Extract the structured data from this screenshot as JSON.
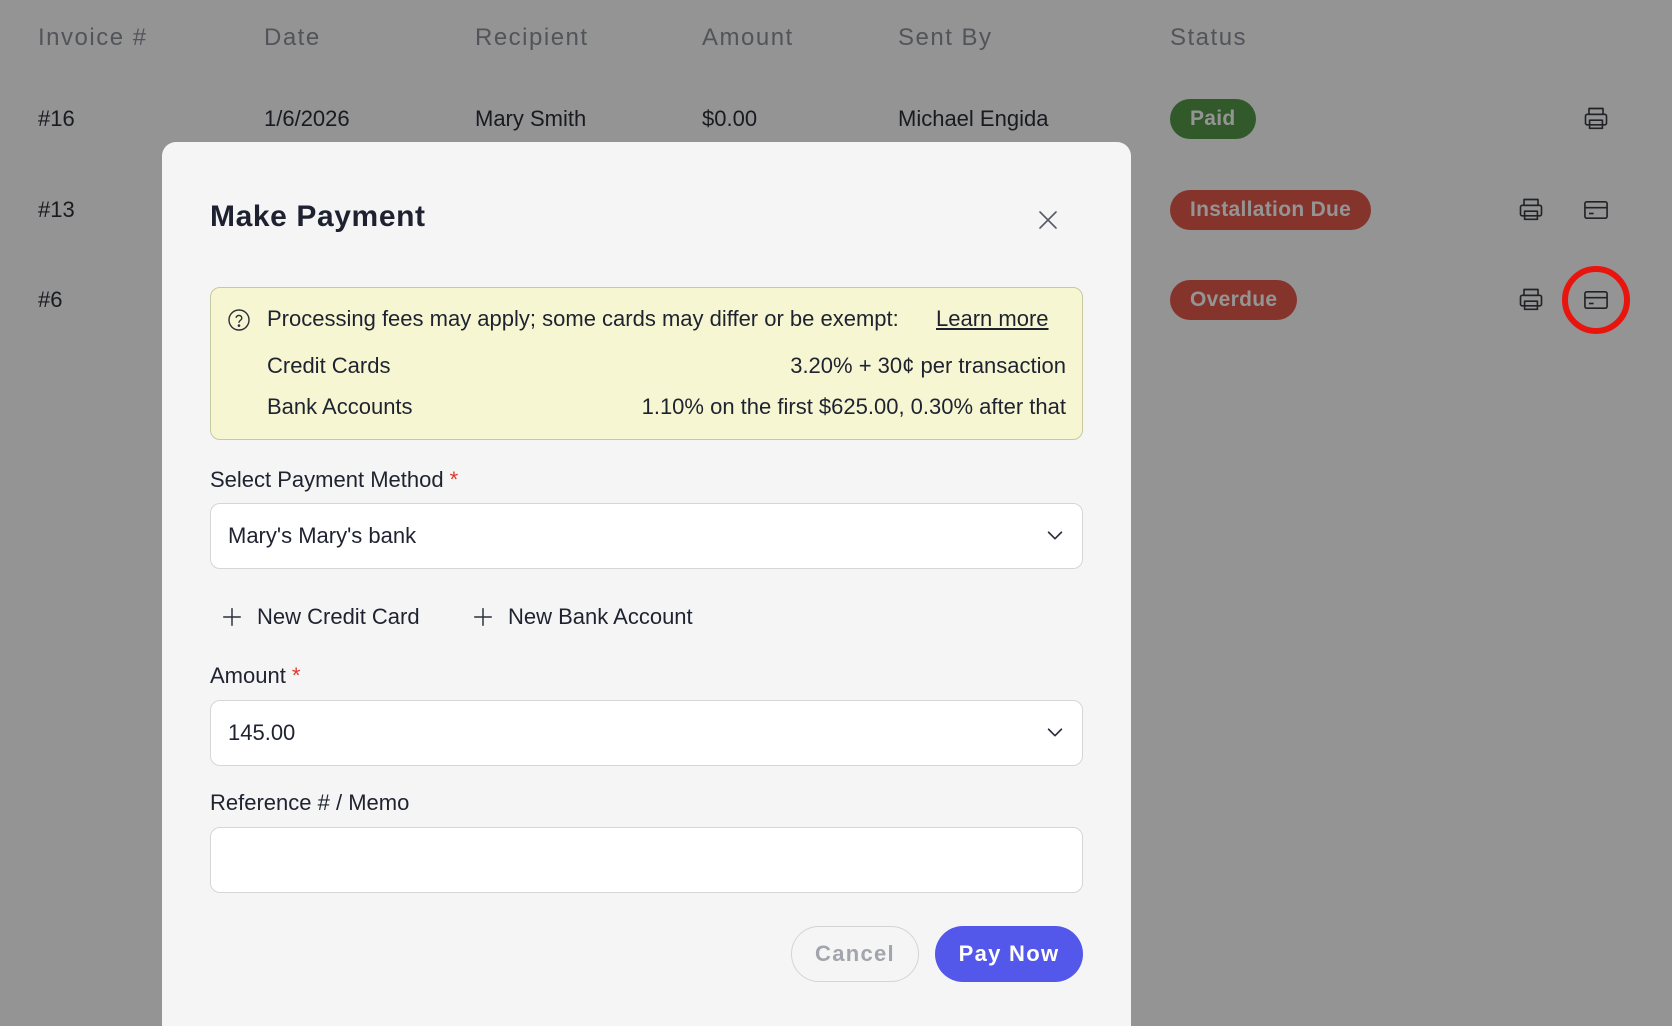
{
  "table": {
    "headers": [
      "Invoice #",
      "Date",
      "Recipient",
      "Amount",
      "Sent By",
      "Status"
    ],
    "rows": [
      {
        "invoice": "#16",
        "date": "1/6/2026",
        "recipient": "Mary Smith",
        "amount": "$0.00",
        "sent_by": "Michael Engida",
        "status": "Paid"
      },
      {
        "invoice": "#13",
        "date": "",
        "recipient": "",
        "amount": "",
        "sent_by": "",
        "status": "Installation Due"
      },
      {
        "invoice": "#6",
        "date": "",
        "recipient": "",
        "amount": "",
        "sent_by": "",
        "status": "Overdue"
      }
    ]
  },
  "status_colors": {
    "Paid": "#559a48",
    "Installation Due": "#e55a4a",
    "Overdue": "#e55a4a"
  },
  "icons": {
    "print": "printer-icon",
    "pay": "credit-card-icon",
    "close": "close-icon",
    "help": "question-circle-icon",
    "add": "plus-icon",
    "dropdown": "chevron-down-icon"
  },
  "modal": {
    "title": "Make Payment",
    "fees": {
      "message": "Processing fees may apply; some cards may differ or be exempt:",
      "link": "Learn more",
      "rows": [
        {
          "label": "Credit Cards",
          "rate": "3.20% + 30¢ per transaction"
        },
        {
          "label": "Bank Accounts",
          "rate": "1.10% on the first $625.00, 0.30% after that"
        }
      ]
    },
    "payment_method": {
      "label": "Select Payment Method",
      "required_mark": "*",
      "value": "Mary's Mary's bank"
    },
    "new_credit_card": "New Credit Card",
    "new_bank_account": "New Bank Account",
    "amount": {
      "label": "Amount",
      "required_mark": "*",
      "value": "145.00"
    },
    "memo": {
      "label": "Reference # / Memo",
      "value": ""
    },
    "cancel_label": "Cancel",
    "pay_label": "Pay Now"
  },
  "colors": {
    "primary": "#5357ea",
    "fee_box_bg": "#f6f6d2",
    "required": "#e0352b",
    "highlight_ring": "#e8150f"
  }
}
